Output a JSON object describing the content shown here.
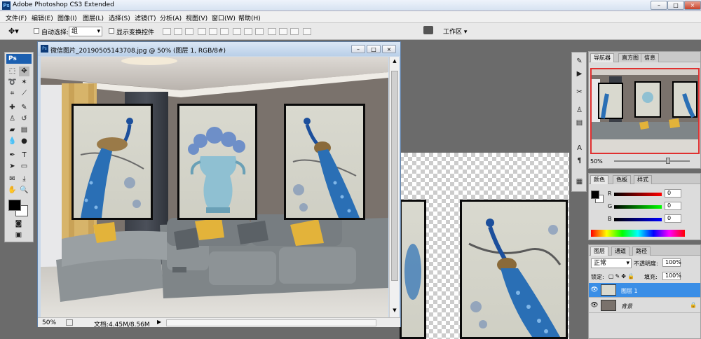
{
  "app": {
    "title": "Adobe Photoshop CS3 Extended"
  },
  "menu": [
    "文件(F)",
    "编辑(E)",
    "图像(I)",
    "图层(L)",
    "选择(S)",
    "滤镜(T)",
    "分析(A)",
    "视图(V)",
    "窗口(W)",
    "帮助(H)"
  ],
  "options": {
    "auto_select_label": "自动选择:",
    "auto_select_value": "组",
    "show_transform_label": "显示变换控件",
    "workspace_label": "工作区 ▾"
  },
  "toolbox": {
    "logo": "Ps"
  },
  "document": {
    "title": "微信图片_20190505143708.jpg @ 50% (图层 1, RGB/8#)",
    "zoom": "50%",
    "doc_size": "文档:4.45M/8.56M"
  },
  "navigator": {
    "tabs": [
      "导航器",
      "直方图",
      "信息"
    ],
    "zoom": "50%"
  },
  "color": {
    "tabs": [
      "颜色",
      "色板",
      "样式"
    ],
    "r_label": "R",
    "g_label": "G",
    "b_label": "B",
    "r": "0",
    "g": "0",
    "b": "0"
  },
  "layers": {
    "tabs": [
      "图层",
      "通道",
      "路径"
    ],
    "blend_mode": "正常",
    "opacity_label": "不透明度:",
    "opacity": "100%",
    "lock_label": "锁定:",
    "fill_label": "填充:",
    "fill": "100%",
    "items": [
      {
        "name": "图层 1",
        "selected": true
      },
      {
        "name": "背景",
        "selected": false
      }
    ]
  },
  "colors": {
    "accent": "#1b5fb0",
    "selected_layer": "#3a8ee6",
    "wall": "#7a726c",
    "sofa": "#8d9396",
    "pillow": "#e3b33a",
    "peacock_blue": "#2a6fb5"
  }
}
